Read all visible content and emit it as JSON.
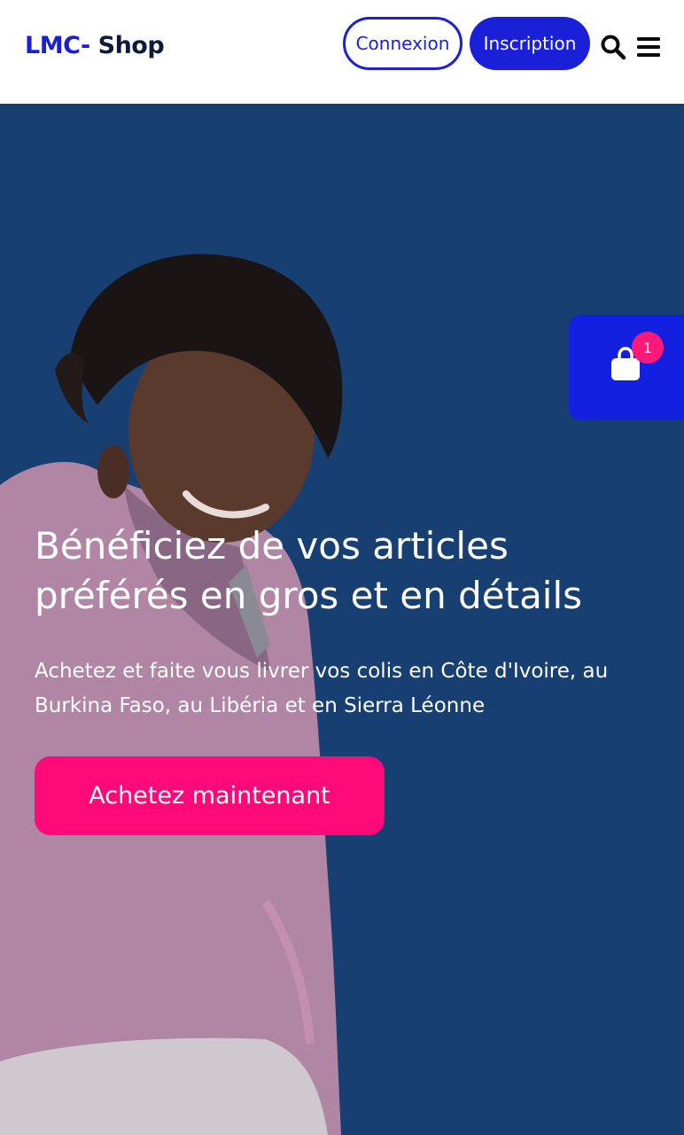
{
  "header": {
    "logo_part1": "LMC-",
    "logo_part2": " Shop",
    "login_label": "Connexion",
    "signup_label": "Inscription",
    "search_icon": "search-icon",
    "menu_icon": "hamburger-menu-icon"
  },
  "cart": {
    "icon": "shopping-bag-icon",
    "count": "1"
  },
  "hero": {
    "title": "Bénéficiez de vos articles préférés en gros et en détails",
    "subtitle": "Achetez et faite vous livrer vos colis en Côte d'Ivoire, au Burkina Faso, au Libéria et en Sierra Léonne",
    "cta_label": "Achetez maintenant"
  },
  "colors": {
    "brand_blue": "#1a1fd8",
    "hero_bg": "#173f72",
    "cta_pink": "#ff0a78",
    "badge_pink": "#ff1a7a"
  }
}
